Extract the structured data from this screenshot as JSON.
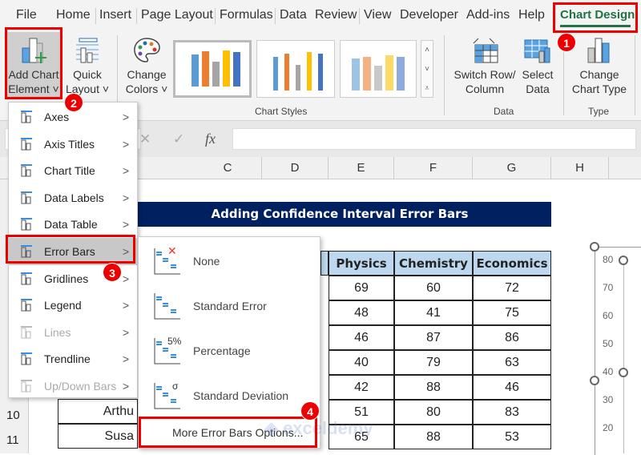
{
  "tabs": [
    "File",
    "Home",
    "Insert",
    "Page Layout",
    "Formulas",
    "Data",
    "Review",
    "View",
    "Developer",
    "Add-ins",
    "Help",
    "Chart Design"
  ],
  "ribbon": {
    "add_chart_element": [
      "Add Chart",
      "Element ˅"
    ],
    "quick_layout": [
      "Quick",
      "Layout ˅"
    ],
    "change_colors": [
      "Change",
      "Colors ˅"
    ],
    "chart_styles_label": "Chart Styles",
    "switch_row_column": [
      "Switch Row/",
      "Column"
    ],
    "select_data": [
      "Select",
      "Data"
    ],
    "data_label": "Data",
    "change_chart_type": [
      "Change",
      "Chart Type"
    ],
    "type_label": "Type"
  },
  "formula_bar": {
    "cancel": "✕",
    "enter": "✓",
    "fx": "fx",
    "value": ""
  },
  "columns": [
    "C",
    "D",
    "E",
    "F",
    "G",
    "H"
  ],
  "rows": [
    "10",
    "11"
  ],
  "sheet": {
    "title": "Adding Confidence Interval Error Bars",
    "headers": [
      "Physics",
      "Chemistry",
      "Economics"
    ],
    "data": [
      [
        69,
        60,
        72
      ],
      [
        48,
        41,
        75
      ],
      [
        46,
        87,
        86
      ],
      [
        40,
        79,
        63
      ],
      [
        42,
        88,
        46
      ],
      [
        51,
        80,
        83
      ],
      [
        65,
        88,
        53
      ]
    ],
    "names_visible": [
      "Arthu",
      "Susa"
    ]
  },
  "menu": {
    "items": [
      {
        "label": "Axes",
        "disabled": false
      },
      {
        "label": "Axis Titles",
        "disabled": false
      },
      {
        "label": "Chart Title",
        "disabled": false
      },
      {
        "label": "Data Labels",
        "disabled": false
      },
      {
        "label": "Data Table",
        "disabled": false
      },
      {
        "label": "Error Bars",
        "disabled": false
      },
      {
        "label": "Gridlines",
        "disabled": false
      },
      {
        "label": "Legend",
        "disabled": false
      },
      {
        "label": "Lines",
        "disabled": true
      },
      {
        "label": "Trendline",
        "disabled": false
      },
      {
        "label": "Up/Down Bars",
        "disabled": true
      }
    ]
  },
  "submenu": {
    "items": [
      "None",
      "Standard Error",
      "Percentage",
      "Standard Deviation"
    ],
    "icon_marks": [
      "✕",
      "",
      "5%",
      "σ"
    ],
    "more": "More Error Bars Options..."
  },
  "badges": [
    "1",
    "2",
    "3",
    "4"
  ],
  "chart_axis": [
    "80",
    "70",
    "60",
    "50",
    "40",
    "30",
    "20"
  ],
  "watermark": "exceldemy",
  "colors": {
    "title_bg": "#002060",
    "header_bg": "#bdd7ee",
    "accent": "#217346",
    "highlight": "#e00000"
  }
}
